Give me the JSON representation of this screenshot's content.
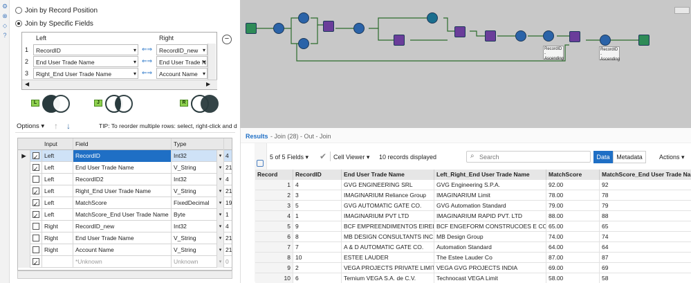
{
  "join": {
    "opt_position": "Join by Record Position",
    "opt_fields": "Join by Specific Fields",
    "hdr_left": "Left",
    "hdr_right": "Right",
    "rows": [
      {
        "n": "1",
        "left": "RecordID",
        "right": "RecordID_new"
      },
      {
        "n": "2",
        "left": "End User Trade Name",
        "right": "End User Trade N"
      },
      {
        "n": "3",
        "left": "Right_End User Trade Name",
        "right": "Account Name"
      }
    ],
    "venn": [
      {
        "tag": "L",
        "color": "#8fd14f"
      },
      {
        "tag": "J",
        "color": "#8fd14f"
      },
      {
        "tag": "R",
        "color": "#8fd14f"
      }
    ]
  },
  "options": {
    "label": "Options",
    "tip": "TIP: To reorder multiple rows: select, right-click and d"
  },
  "fields": {
    "headers": [
      "Input",
      "Field",
      "Type",
      ""
    ],
    "rows": [
      {
        "checked": true,
        "input": "Left",
        "field": "RecordID",
        "type": "Int32",
        "size": "4",
        "selected": true
      },
      {
        "checked": true,
        "input": "Left",
        "field": "End User Trade Name",
        "type": "V_String",
        "size": "21"
      },
      {
        "checked": false,
        "input": "Left",
        "field": "RecordID2",
        "type": "Int32",
        "size": "4"
      },
      {
        "checked": true,
        "input": "Left",
        "field": "Right_End User Trade Name",
        "type": "V_String",
        "size": "21"
      },
      {
        "checked": true,
        "input": "Left",
        "field": "MatchScore",
        "type": "FixedDecimal",
        "size": "19"
      },
      {
        "checked": true,
        "input": "Left",
        "field": "MatchScore_End User Trade Name",
        "type": "Byte",
        "size": "1"
      },
      {
        "checked": false,
        "input": "Right",
        "field": "RecordID_new",
        "type": "Int32",
        "size": "4"
      },
      {
        "checked": false,
        "input": "Right",
        "field": "End User Trade Name",
        "type": "V_String",
        "size": "21"
      },
      {
        "checked": false,
        "input": "Right",
        "field": "Account Name",
        "type": "V_String",
        "size": "21"
      },
      {
        "checked": true,
        "input": "",
        "field": "*Unknown",
        "type": "Unknown",
        "size": "0",
        "muted": true
      }
    ]
  },
  "canvas": {
    "labels": [
      "RecordID - Ascending",
      "RecordID - Ascending"
    ]
  },
  "results": {
    "title": "Results",
    "subtitle": "- Join (28) - Out - Join",
    "fields_count": "5 of 5 Fields",
    "cell_viewer": "Cell Viewer",
    "records_displayed": "10 records displayed",
    "search_placeholder": "Search",
    "tab_data": "Data",
    "tab_metadata": "Metadata",
    "actions": "Actions",
    "columns": [
      "Record",
      "RecordID",
      "End User Trade Name",
      "Left_Right_End User Trade Name",
      "MatchScore",
      "MatchScore_End User Trade Name"
    ],
    "rows": [
      [
        "1",
        "4",
        "GVG ENGINEERING SRL",
        "GVG Engineering S.P.A.",
        "92.00",
        "92"
      ],
      [
        "2",
        "3",
        "IMAGINARIUM  Reliance Group",
        "IMAGINARIUM Limit",
        "78.00",
        "78"
      ],
      [
        "3",
        "5",
        "GVG AUTOMATIC GATE CO.",
        "GVG Automation Standard",
        "79.00",
        "79"
      ],
      [
        "4",
        "1",
        "IMAGINARIUM  PVT LTD",
        "IMAGINARIUM RAPID PVT. LTD",
        "88.00",
        "88"
      ],
      [
        "5",
        "9",
        "BCF EMPREENDIMENTOS EIRELI",
        "BCF ENGEFORM CONSTRUCOES E COMERCIO",
        "65.00",
        "65"
      ],
      [
        "6",
        "8",
        "MB DESIGN CONSULTANTS INC.",
        "MB Design Group",
        "74.00",
        "74"
      ],
      [
        "7",
        "7",
        "A & D AUTOMATIC GATE CO.",
        "Automation Standard",
        "64.00",
        "64"
      ],
      [
        "8",
        "10",
        "ESTEE LAUDER",
        "The Estee Lauder Co",
        "87.00",
        "87"
      ],
      [
        "9",
        "2",
        "VEGA PROJECTS PRIVATE LIMITE",
        "VEGA GVG PROJECTS INDIA",
        "69.00",
        "69"
      ],
      [
        "10",
        "6",
        "Ternium VEGA S.A. de C.V.",
        "Technocast VEGA Limit",
        "58.00",
        "58"
      ]
    ]
  },
  "colors": {
    "accent": "#1f6fc5",
    "canvas": "#c8c8c8",
    "green": "#8fd14f"
  }
}
